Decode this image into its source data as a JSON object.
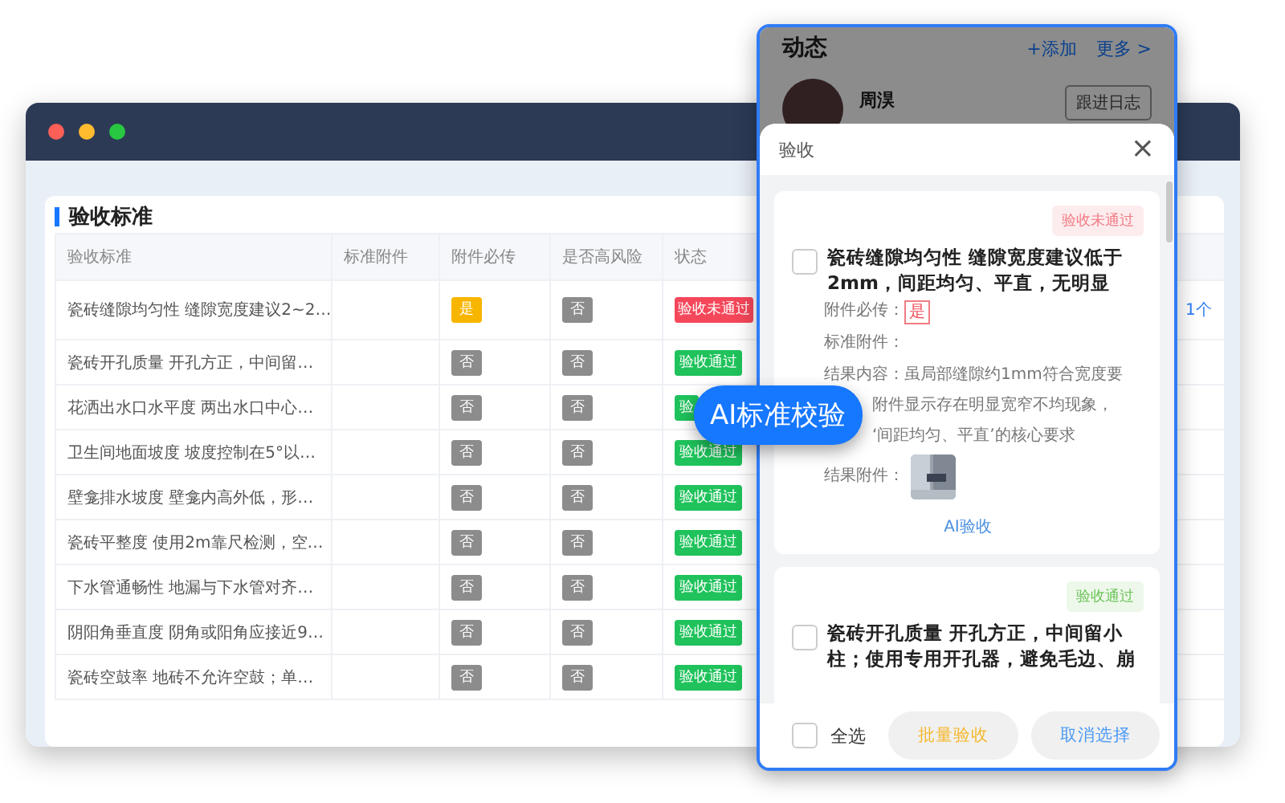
{
  "back_window": {
    "section_title": "验收标准",
    "table": {
      "columns": [
        "验收标准",
        "标准附件",
        "附件必传",
        "是否高风险",
        "状态"
      ],
      "rows": [
        {
          "standard": "瓷砖缝隙均匀性 缝隙宽度建议2~2…",
          "required": {
            "text": "是",
            "kind": "yes"
          },
          "high_risk": {
            "text": "否",
            "kind": "no"
          },
          "status": {
            "text": "验收未通过",
            "kind": "fail"
          },
          "column_6": "1个"
        },
        {
          "standard": "瓷砖开孔质量 开孔方正，中间留…",
          "required": {
            "text": "否",
            "kind": "no"
          },
          "high_risk": {
            "text": "否",
            "kind": "no"
          },
          "status": {
            "text": "验收通过",
            "kind": "pass"
          }
        },
        {
          "standard": "花洒出水口水平度 两出水口中心…",
          "required": {
            "text": "否",
            "kind": "no"
          },
          "high_risk": {
            "text": "否",
            "kind": "no"
          },
          "status": {
            "text": "验",
            "kind": "pass"
          }
        },
        {
          "standard": "卫生间地面坡度 坡度控制在5°以…",
          "required": {
            "text": "否",
            "kind": "no"
          },
          "high_risk": {
            "text": "否",
            "kind": "no"
          },
          "status": {
            "text": "验收通过",
            "kind": "pass"
          }
        },
        {
          "standard": "壁龛排水坡度 壁龛内高外低，形…",
          "required": {
            "text": "否",
            "kind": "no"
          },
          "high_risk": {
            "text": "否",
            "kind": "no"
          },
          "status": {
            "text": "验收通过",
            "kind": "pass"
          }
        },
        {
          "standard": "瓷砖平整度 使用2m靠尺检测，空…",
          "required": {
            "text": "否",
            "kind": "no"
          },
          "high_risk": {
            "text": "否",
            "kind": "no"
          },
          "status": {
            "text": "验收通过",
            "kind": "pass"
          }
        },
        {
          "standard": "下水管通畅性 地漏与下水管对齐…",
          "required": {
            "text": "否",
            "kind": "no"
          },
          "high_risk": {
            "text": "否",
            "kind": "no"
          },
          "status": {
            "text": "验收通过",
            "kind": "pass"
          }
        },
        {
          "standard": "阴阳角垂直度 阴角或阳角应接近9…",
          "required": {
            "text": "否",
            "kind": "no"
          },
          "high_risk": {
            "text": "否",
            "kind": "no"
          },
          "status": {
            "text": "验收通过",
            "kind": "pass"
          }
        },
        {
          "standard": "瓷砖空鼓率 地砖不允许空鼓；单…",
          "required": {
            "text": "否",
            "kind": "no"
          },
          "high_risk": {
            "text": "否",
            "kind": "no"
          },
          "status": {
            "text": "验收通过",
            "kind": "pass"
          }
        }
      ]
    }
  },
  "phone": {
    "feed": {
      "title": "动态",
      "add": "+添加",
      "more": "更多 >",
      "user_name": "周淏",
      "log_button": "跟进日志"
    },
    "sheet": {
      "title": "验收",
      "close": "×",
      "cards": [
        {
          "status": {
            "text": "验收未通过",
            "kind": "fail"
          },
          "checked": false,
          "title": "瓷砖缝隙均匀性 缝隙宽度建议低于2mm，间距均匀、平直，无明显",
          "required_label": "附件必传：",
          "required_value": "是",
          "attachment_label": "标准附件：",
          "result_lines": [
            "结果内容：虽局部缝隙约1mm符合宽度要",
            "附件显示存在明显宽窄不均现象，",
            "‘间距均匀、平直’的核心要求"
          ],
          "result_attachment_label": "结果附件：",
          "ai_link": "AI验收"
        },
        {
          "status": {
            "text": "验收通过",
            "kind": "pass"
          },
          "checked": false,
          "title": "瓷砖开孔质量 开孔方正，中间留小柱；使用专用开孔器，避免毛边、崩"
        }
      ],
      "footer": {
        "select_all": {
          "label": "全选",
          "checked": false
        },
        "batch_button": "批量验收",
        "cancel_button": "取消选择"
      }
    }
  },
  "floating_label": "AI标准校验"
}
